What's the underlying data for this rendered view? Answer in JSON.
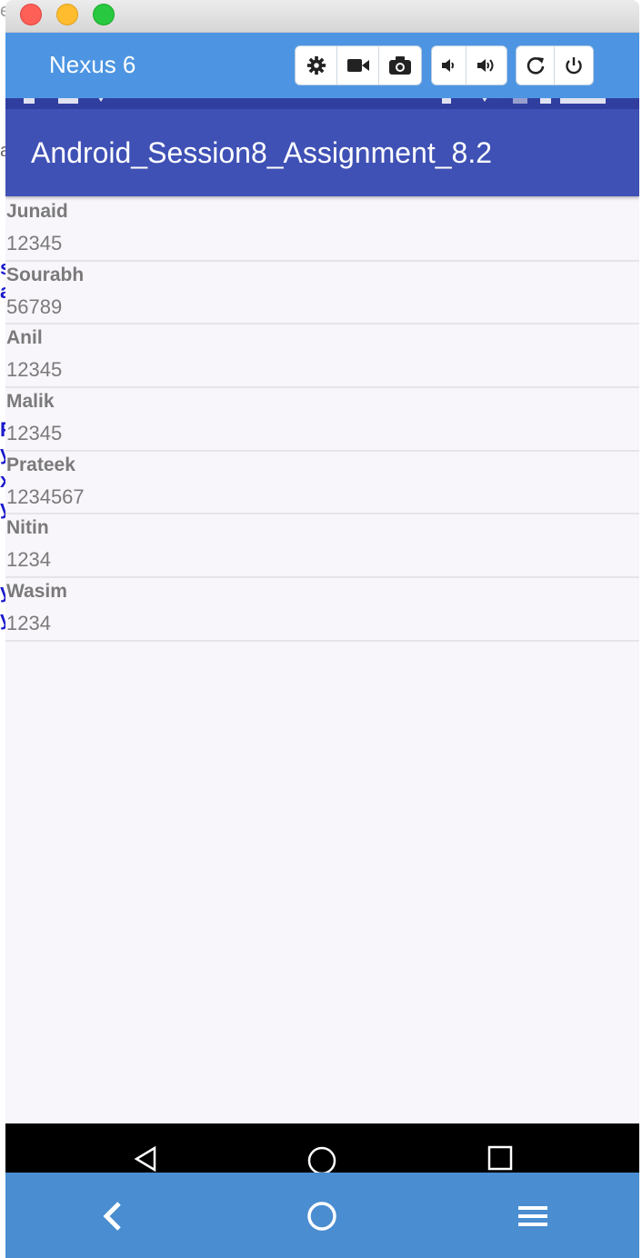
{
  "window": {
    "controls": [
      "close-button",
      "minimize-button",
      "maximize-button"
    ]
  },
  "emulator": {
    "device_name": "Nexus 6",
    "toolbar_icons": [
      "gear-icon",
      "video-camera-icon",
      "camera-icon",
      "volume-down-icon",
      "volume-up-icon",
      "rotate-icon",
      "power-icon"
    ],
    "bottom_icons": [
      "back-chevron-icon",
      "home-circle-icon",
      "menu-icon"
    ]
  },
  "app": {
    "title": "Android_Session8_Assignment_8.2",
    "colors": {
      "status_bar": "#303f9f",
      "action_bar": "#3f51b5",
      "emulator_bar": "#4d95e2"
    }
  },
  "contacts": [
    {
      "name": "Junaid",
      "phone": "12345"
    },
    {
      "name": "Sourabh",
      "phone": "56789"
    },
    {
      "name": "Anil",
      "phone": "12345"
    },
    {
      "name": "Malik",
      "phone": "12345"
    },
    {
      "name": "Prateek",
      "phone": "1234567"
    },
    {
      "name": "Nitin",
      "phone": "1234"
    },
    {
      "name": "Wasim",
      "phone": "1234"
    }
  ],
  "navigation": {
    "icons": [
      "back-triangle-icon",
      "home-icon",
      "recents-icon"
    ]
  },
  "background": {
    "partial_chars": [
      "e",
      "a",
      "s",
      "a",
      "F",
      "y",
      "x",
      "y",
      "y",
      "y"
    ]
  }
}
